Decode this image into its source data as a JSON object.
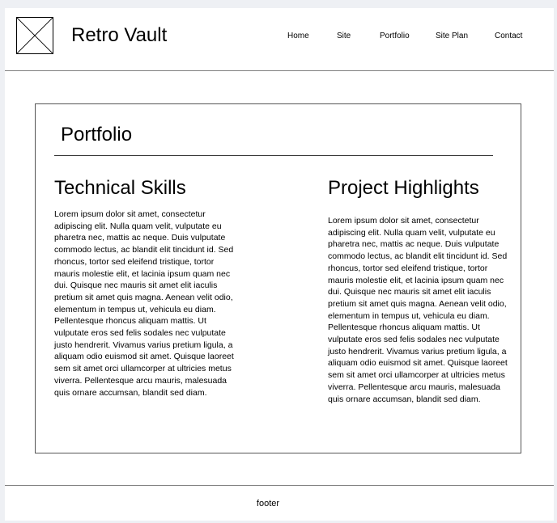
{
  "header": {
    "logo_icon": "image-placeholder-icon",
    "site_title": "Retro Vault",
    "nav": [
      {
        "label": "Home"
      },
      {
        "label": "Site"
      },
      {
        "label": "Portfolio"
      },
      {
        "label": "Site Plan"
      },
      {
        "label": "Contact"
      }
    ]
  },
  "main": {
    "page_title": "Portfolio",
    "columns": [
      {
        "title": "Technical Skills",
        "body": "Lorem ipsum dolor sit amet, consectetur adipiscing elit. Nulla quam velit, vulputate eu pharetra nec, mattis ac neque. Duis vulputate commodo lectus, ac blandit elit tincidunt id. Sed rhoncus, tortor sed eleifend tristique, tortor mauris molestie elit, et lacinia ipsum quam nec dui. Quisque nec mauris sit amet elit iaculis pretium sit amet quis magna. Aenean velit odio, elementum in tempus ut, vehicula eu diam. Pellentesque rhoncus aliquam mattis. Ut vulputate eros sed felis sodales nec vulputate justo hendrerit. Vivamus varius pretium ligula, a aliquam odio euismod sit amet. Quisque laoreet sem sit amet orci ullamcorper at ultricies metus viverra. Pellentesque arcu mauris, malesuada quis ornare accumsan, blandit sed diam."
      },
      {
        "title": "Project Highlights",
        "body": "Lorem ipsum dolor sit amet, consectetur adipiscing elit. Nulla quam velit, vulputate eu pharetra nec, mattis ac neque. Duis vulputate commodo lectus, ac blandit elit tincidunt id. Sed rhoncus, tortor sed eleifend tristique, tortor mauris molestie elit, et lacinia ipsum quam nec dui. Quisque nec mauris sit amet elit iaculis pretium sit amet quis magna. Aenean velit odio, elementum in tempus ut, vehicula eu diam. Pellentesque rhoncus aliquam mattis. Ut vulputate eros sed felis sodales nec vulputate justo hendrerit. Vivamus varius pretium ligula, a aliquam odio euismod sit amet. Quisque laoreet sem sit amet orci ullamcorper at ultricies metus viverra. Pellentesque arcu mauris, malesuada quis ornare accumsan, blandit sed diam."
      }
    ]
  },
  "footer": {
    "text": "footer"
  },
  "colors": {
    "page_background": "#eef0f4",
    "surface": "#ffffff",
    "divider": "#808080",
    "text": "#000000"
  }
}
